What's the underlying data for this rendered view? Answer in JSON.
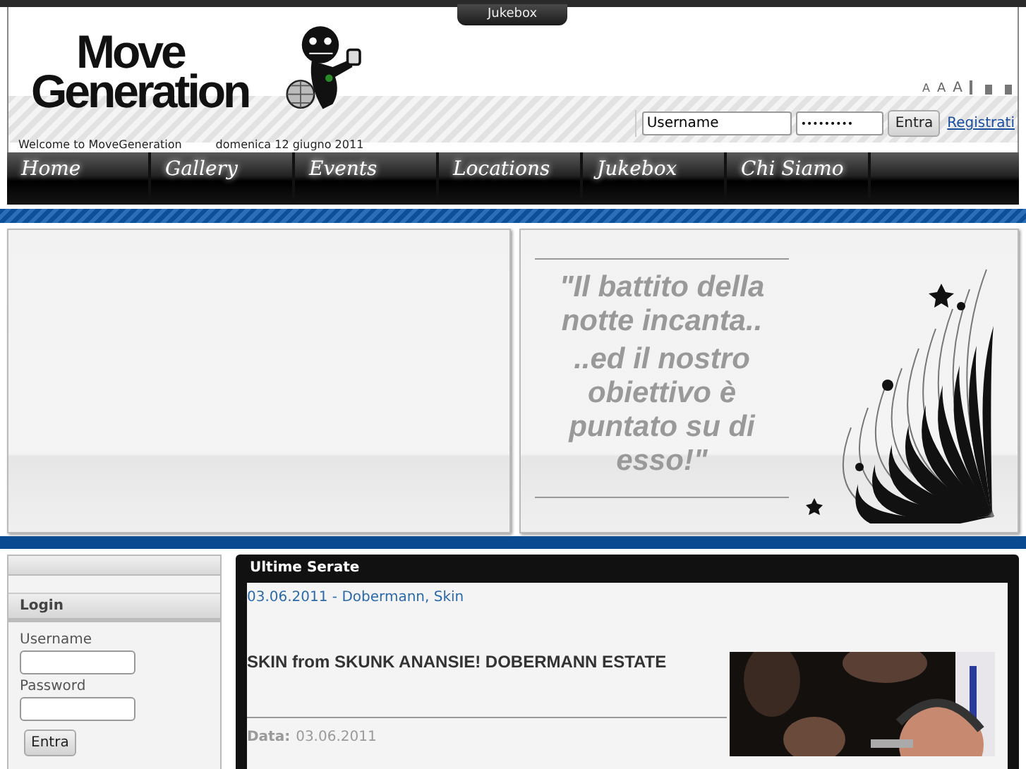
{
  "top_tab": {
    "label": "Jukebox"
  },
  "logo": {
    "line_1": "Move",
    "line_2": "Generation"
  },
  "font_size_controls": [
    "A",
    "A",
    "A"
  ],
  "welcome": "Welcome to MoveGeneration",
  "date": "domenica 12 giugno 2011",
  "header_login": {
    "username": {
      "value": "Username"
    },
    "password": {
      "value": "•••••••••"
    },
    "button": "Entra",
    "register_link": "Registrati"
  },
  "nav": [
    {
      "label": "Home"
    },
    {
      "label": "Gallery"
    },
    {
      "label": "Events"
    },
    {
      "label": "Locations"
    },
    {
      "label": "Jukebox"
    },
    {
      "label": "Chi Siamo"
    }
  ],
  "quote": [
    "\"Il battito della notte incanta..",
    "..ed il nostro obiettivo è puntato su di esso!\""
  ],
  "sidebar": {
    "title": "Login",
    "username_label": "Username",
    "password_label": "Password",
    "button": "Entra"
  },
  "main": {
    "title": "Ultime Serate",
    "event_link": "03.06.2011 - Dobermann, Skin",
    "headline": "SKIN from SKUNK ANANSIE! DOBERMANN ESTATE",
    "data_label": "Data:",
    "data_value": "03.06.2011"
  }
}
